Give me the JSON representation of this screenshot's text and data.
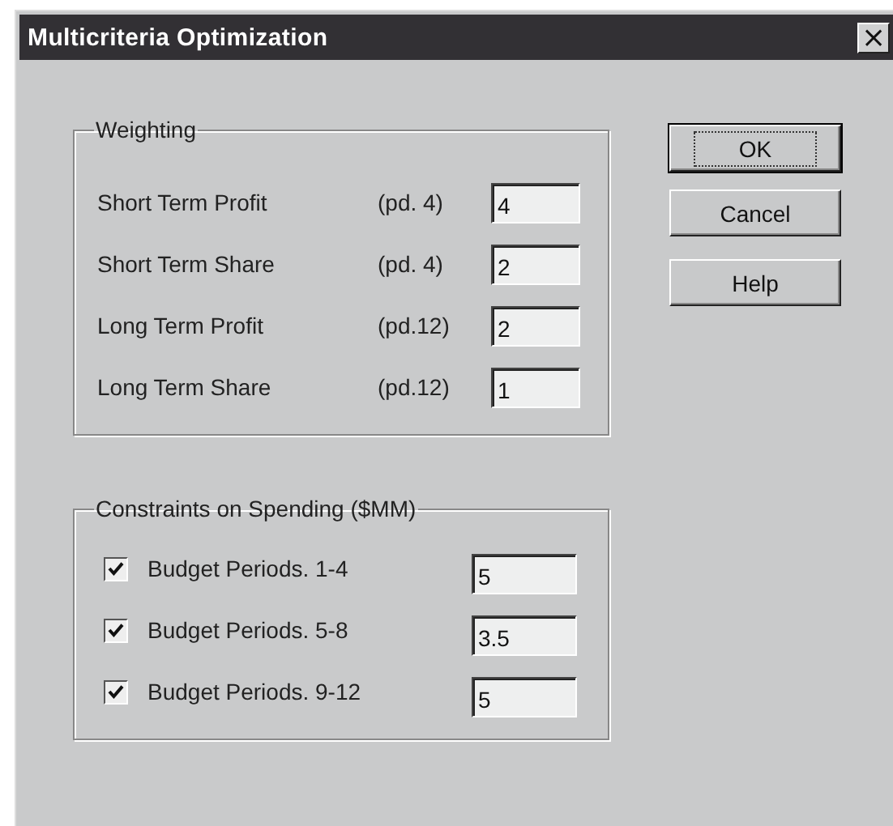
{
  "window": {
    "title": "Multicriteria Optimization",
    "close": "×"
  },
  "weighting": {
    "title": "Weighting",
    "rows": [
      {
        "label": "Short Term Profit",
        "period": "(pd. 4)",
        "value": "4"
      },
      {
        "label": "Short Term Share",
        "period": "(pd. 4)",
        "value": "2"
      },
      {
        "label": "Long Term Profit",
        "period": "(pd.12)",
        "value": "2"
      },
      {
        "label": "Long Term Share",
        "period": "(pd.12)",
        "value": "1"
      }
    ]
  },
  "constraints": {
    "title": "Constraints on Spending ($MM)",
    "rows": [
      {
        "label": "Budget Periods. 1-4",
        "checked": true,
        "value": "5"
      },
      {
        "label": "Budget Periods. 5-8",
        "checked": true,
        "value": "3.5"
      },
      {
        "label": "Budget Periods. 9-12",
        "checked": true,
        "value": "5"
      }
    ]
  },
  "buttons": [
    {
      "label": "OK",
      "default": true
    },
    {
      "label": "Cancel",
      "default": false
    },
    {
      "label": "Help",
      "default": false
    }
  ]
}
